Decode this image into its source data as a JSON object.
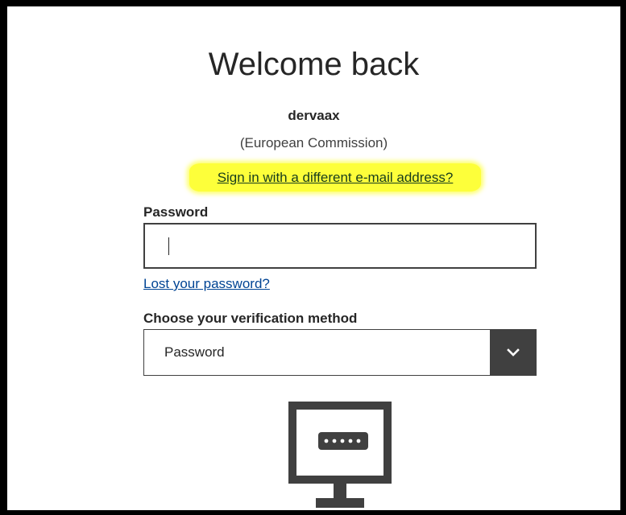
{
  "title": "Welcome back",
  "user": {
    "username": "dervaax",
    "organization": "(European Commission)"
  },
  "links": {
    "different_email": "Sign in with a different e-mail address?",
    "lost_password": "Lost your password?"
  },
  "password_field": {
    "label": "Password",
    "value": ""
  },
  "verification": {
    "label": "Choose your verification method",
    "selected": "Password",
    "dropdown_icon": "chevron-down-icon"
  },
  "illustration_icon": "monitor-password-icon",
  "colors": {
    "highlight": "#fdff3a",
    "link": "#004494",
    "dark": "#404040",
    "frame": "#000000"
  }
}
